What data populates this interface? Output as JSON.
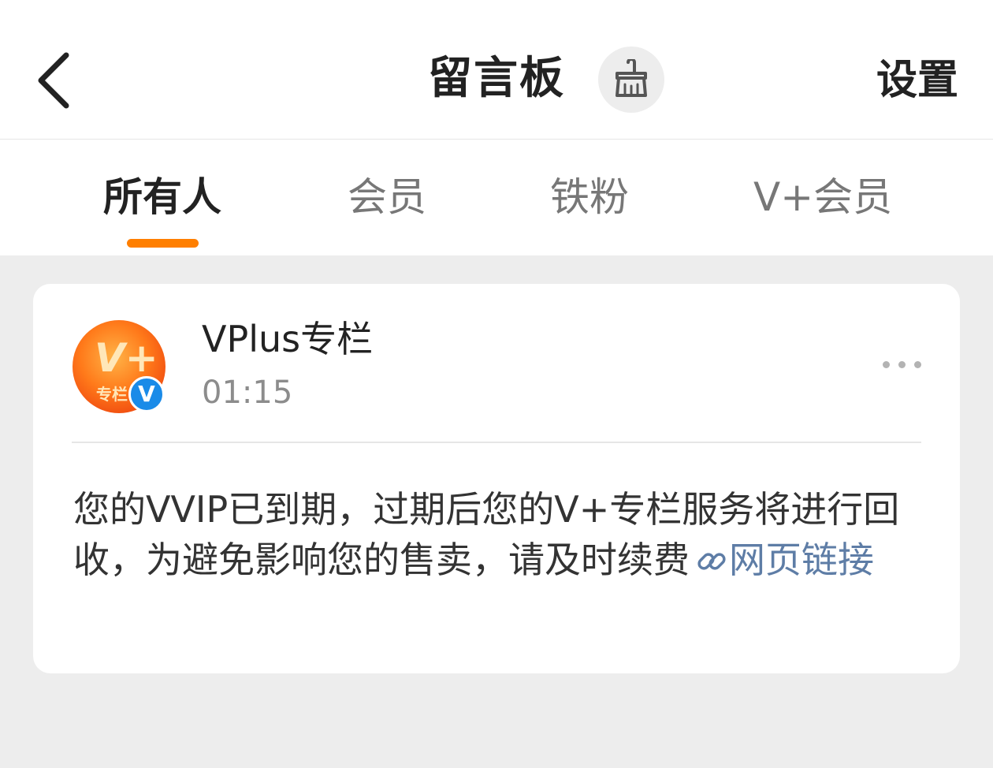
{
  "header": {
    "title": "留言板",
    "settings_label": "设置",
    "back_icon": "back-chevron-icon",
    "clear_icon": "broom-icon"
  },
  "tabs": [
    {
      "label": "所有人",
      "active": true
    },
    {
      "label": "会员",
      "active": false
    },
    {
      "label": "铁粉",
      "active": false
    },
    {
      "label": "V+会员",
      "active": false
    }
  ],
  "colors": {
    "accent": "#ff7f00",
    "link": "#5e7da6",
    "verified": "#1a8be8",
    "background": "#ededed"
  },
  "message": {
    "sender_name": "VPlus专栏",
    "time": "01:15",
    "avatar_logo_text": "V+",
    "avatar_sub_text": "专栏",
    "verified_badge": "V",
    "more_icon": "more-dots-icon",
    "body_text": "您的VVIP已到期，过期后您的V+专栏服务将进行回收，为避免影响您的售卖，请及时续费",
    "link_icon": "link-icon",
    "link_text": "网页链接"
  }
}
